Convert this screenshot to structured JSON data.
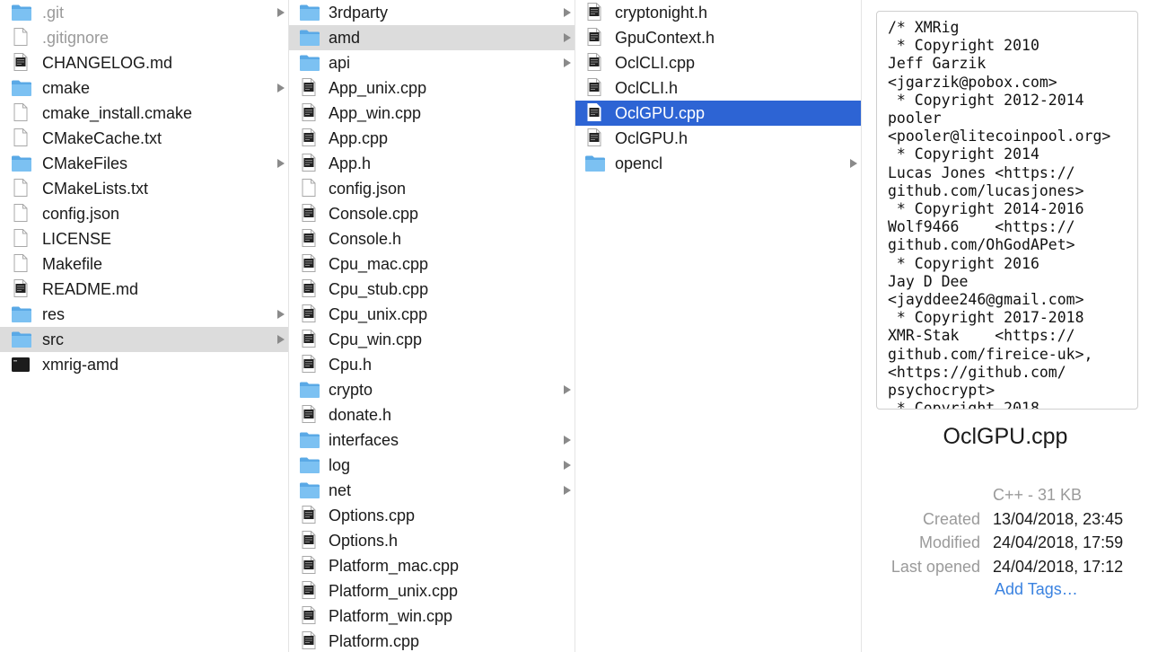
{
  "column1": {
    "items": [
      {
        "label": ".git",
        "kind": "folder",
        "dim": true,
        "chevron": true
      },
      {
        "label": ".gitignore",
        "kind": "file",
        "dim": true
      },
      {
        "label": "CHANGELOG.md",
        "kind": "doc"
      },
      {
        "label": "cmake",
        "kind": "folder",
        "chevron": true
      },
      {
        "label": "cmake_install.cmake",
        "kind": "file"
      },
      {
        "label": "CMakeCache.txt",
        "kind": "file"
      },
      {
        "label": "CMakeFiles",
        "kind": "folder",
        "chevron": true
      },
      {
        "label": "CMakeLists.txt",
        "kind": "file"
      },
      {
        "label": "config.json",
        "kind": "file"
      },
      {
        "label": "LICENSE",
        "kind": "file"
      },
      {
        "label": "Makefile",
        "kind": "file"
      },
      {
        "label": "README.md",
        "kind": "doc"
      },
      {
        "label": "res",
        "kind": "folder",
        "chevron": true
      },
      {
        "label": "src",
        "kind": "folder",
        "chevron": true,
        "highlight": true
      },
      {
        "label": "xmrig-amd",
        "kind": "exec"
      }
    ]
  },
  "column2": {
    "items": [
      {
        "label": "3rdparty",
        "kind": "folder",
        "chevron": true
      },
      {
        "label": "amd",
        "kind": "folder",
        "chevron": true,
        "highlight": true
      },
      {
        "label": "api",
        "kind": "folder",
        "chevron": true
      },
      {
        "label": "App_unix.cpp",
        "kind": "code"
      },
      {
        "label": "App_win.cpp",
        "kind": "code"
      },
      {
        "label": "App.cpp",
        "kind": "code"
      },
      {
        "label": "App.h",
        "kind": "code"
      },
      {
        "label": "config.json",
        "kind": "file"
      },
      {
        "label": "Console.cpp",
        "kind": "code"
      },
      {
        "label": "Console.h",
        "kind": "code"
      },
      {
        "label": "Cpu_mac.cpp",
        "kind": "code"
      },
      {
        "label": "Cpu_stub.cpp",
        "kind": "code"
      },
      {
        "label": "Cpu_unix.cpp",
        "kind": "code"
      },
      {
        "label": "Cpu_win.cpp",
        "kind": "code"
      },
      {
        "label": "Cpu.h",
        "kind": "code"
      },
      {
        "label": "crypto",
        "kind": "folder",
        "chevron": true
      },
      {
        "label": "donate.h",
        "kind": "code"
      },
      {
        "label": "interfaces",
        "kind": "folder",
        "chevron": true
      },
      {
        "label": "log",
        "kind": "folder",
        "chevron": true
      },
      {
        "label": "net",
        "kind": "folder",
        "chevron": true
      },
      {
        "label": "Options.cpp",
        "kind": "code"
      },
      {
        "label": "Options.h",
        "kind": "code"
      },
      {
        "label": "Platform_mac.cpp",
        "kind": "code"
      },
      {
        "label": "Platform_unix.cpp",
        "kind": "code"
      },
      {
        "label": "Platform_win.cpp",
        "kind": "code"
      },
      {
        "label": "Platform.cpp",
        "kind": "code"
      }
    ]
  },
  "column3": {
    "items": [
      {
        "label": "cryptonight.h",
        "kind": "code"
      },
      {
        "label": "GpuContext.h",
        "kind": "code"
      },
      {
        "label": "OclCLI.cpp",
        "kind": "code"
      },
      {
        "label": "OclCLI.h",
        "kind": "code"
      },
      {
        "label": "OclGPU.cpp",
        "kind": "code",
        "selected": true
      },
      {
        "label": "OclGPU.h",
        "kind": "code"
      },
      {
        "label": "opencl",
        "kind": "folder",
        "chevron": true
      }
    ]
  },
  "preview": {
    "code": "/* XMRig\n * Copyright 2010\nJeff Garzik\n<jgarzik@pobox.com>\n * Copyright 2012-2014\npooler\n<pooler@litecoinpool.org>\n * Copyright 2014\nLucas Jones <https://\ngithub.com/lucasjones>\n * Copyright 2014-2016\nWolf9466    <https://\ngithub.com/OhGodAPet>\n * Copyright 2016\nJay D Dee\n<jayddee246@gmail.com>\n * Copyright 2017-2018\nXMR-Stak    <https://\ngithub.com/fireice-uk>,\n<https://github.com/\npsychocrypt>\n * Copyright 2018",
    "file_name": "OclGPU.cpp",
    "kind_size": "C++ - 31 KB",
    "created_label": "Created",
    "created_value": "13/04/2018, 23:45",
    "modified_label": "Modified",
    "modified_value": "24/04/2018, 17:59",
    "opened_label": "Last opened",
    "opened_value": "24/04/2018, 17:12",
    "add_tags": "Add Tags…"
  },
  "colors": {
    "selection": "#2d64d4",
    "highlight": "#dcdcdc",
    "folder": "#6fb7ee",
    "link": "#3a82e0"
  }
}
